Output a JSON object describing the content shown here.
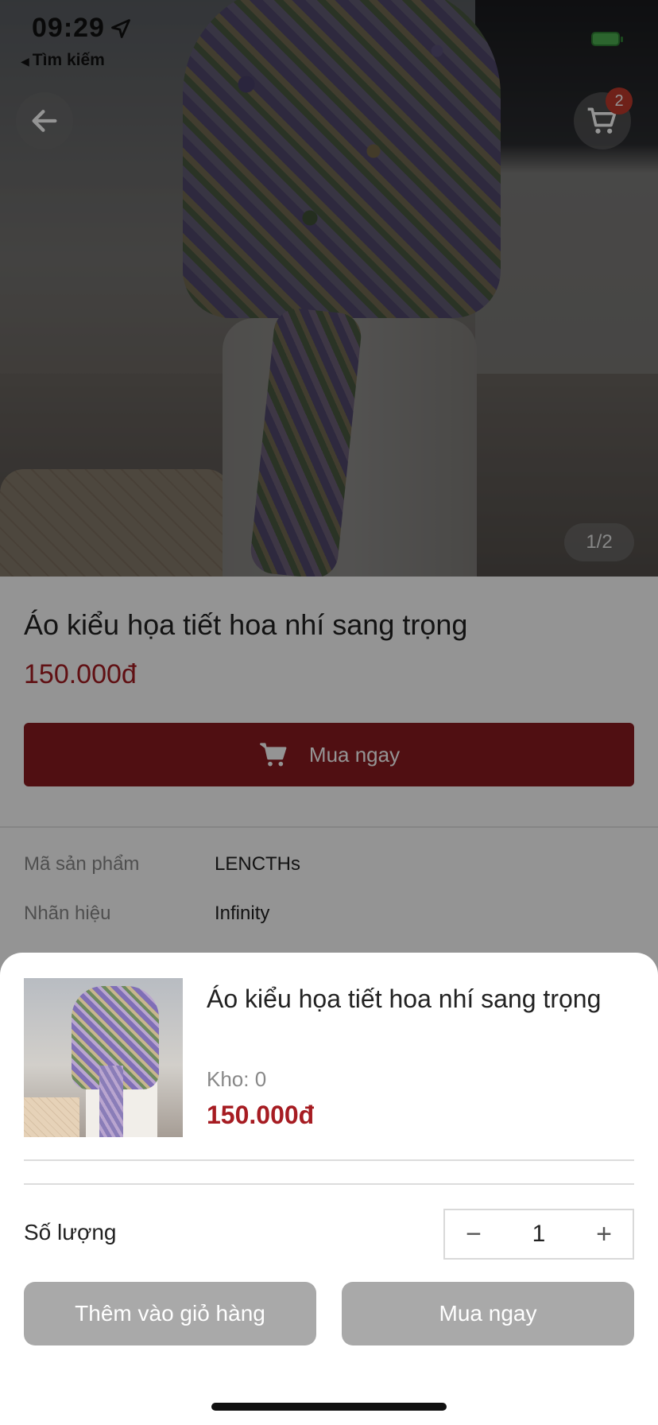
{
  "status_bar": {
    "time": "09:29",
    "back_app_label": "Tìm kiếm",
    "location_icon": "location-arrow-icon",
    "battery_icon": "battery-icon",
    "battery_color": "#4caf50"
  },
  "hero": {
    "image_counter": "1/2",
    "cart_count": "2",
    "back_icon": "arrow-left-icon",
    "cart_icon": "shopping-cart-icon"
  },
  "product": {
    "title": "Áo kiểu họa tiết hoa nhí sang trọng",
    "price": "150.000đ",
    "buy_label": "Mua ngay",
    "specs": [
      {
        "label": "Mã sản phẩm",
        "value": "LENCTHs"
      },
      {
        "label": "Nhãn hiệu",
        "value": "Infinity"
      }
    ]
  },
  "sheet": {
    "title": "Áo kiểu họa tiết hoa nhí sang trọng",
    "stock": "Kho: 0",
    "price": "150.000đ",
    "quantity_label": "Số lượng",
    "quantity_value": "1",
    "minus_symbol": "−",
    "plus_symbol": "+",
    "add_to_cart_label": "Thêm vào giỏ hàng",
    "buy_now_label": "Mua ngay"
  },
  "colors": {
    "accent": "#8b1a1f",
    "price": "#a61c22",
    "disabled_button": "#a9a9a9"
  }
}
